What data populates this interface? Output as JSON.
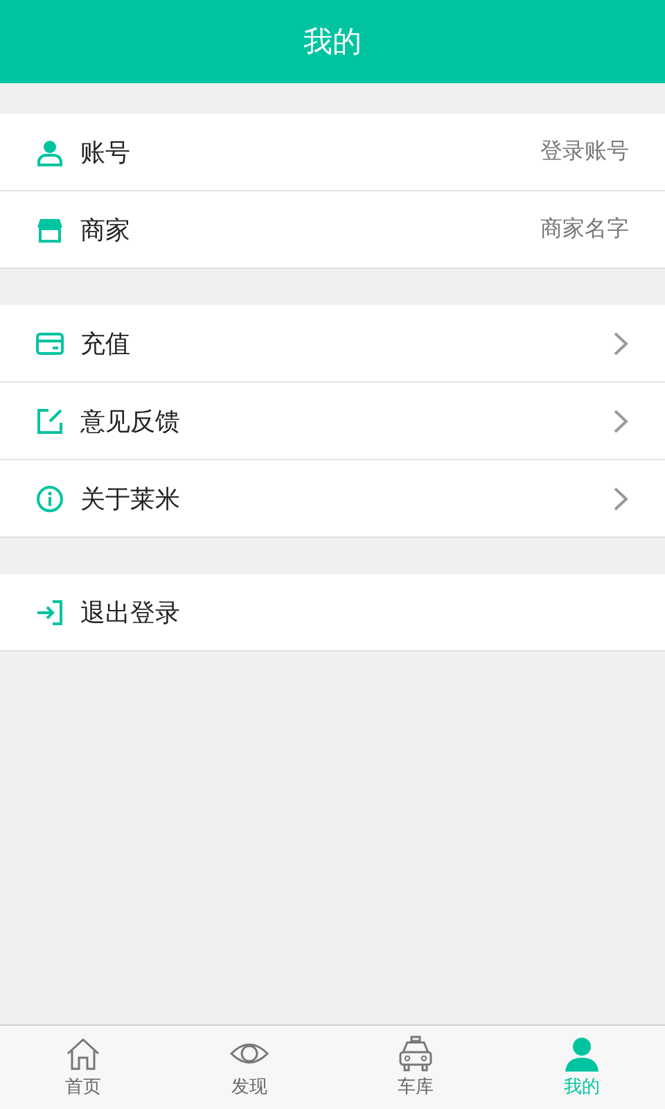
{
  "header": {
    "title": "我的"
  },
  "sections": [
    {
      "rows": [
        {
          "label": "账号",
          "kind": "value",
          "value": "登录账号"
        },
        {
          "label": "商家",
          "kind": "value",
          "value": "商家名字"
        }
      ]
    },
    {
      "rows": [
        {
          "label": "充值",
          "kind": "arrow"
        },
        {
          "label": "意见反馈",
          "kind": "arrow"
        },
        {
          "label": "关于莱米",
          "kind": "arrow"
        }
      ]
    },
    {
      "rows": [
        {
          "label": "退出登录",
          "kind": "plain"
        }
      ]
    }
  ],
  "tabs": [
    {
      "label": "首页",
      "selected": false
    },
    {
      "label": "发现",
      "selected": false
    },
    {
      "label": "车库",
      "selected": false
    },
    {
      "label": "我的",
      "selected": true
    }
  ]
}
